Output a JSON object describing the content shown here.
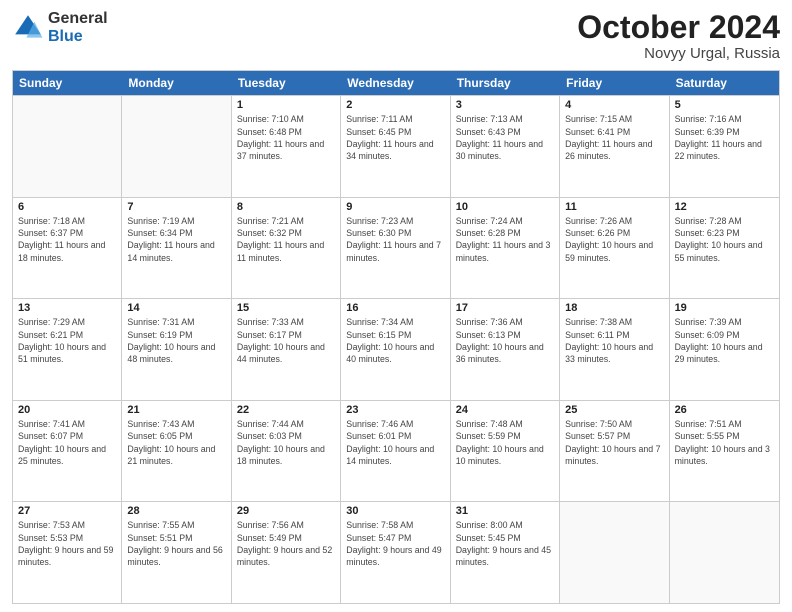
{
  "logo": {
    "general": "General",
    "blue": "Blue"
  },
  "title": "October 2024",
  "subtitle": "Novyy Urgal, Russia",
  "days": [
    "Sunday",
    "Monday",
    "Tuesday",
    "Wednesday",
    "Thursday",
    "Friday",
    "Saturday"
  ],
  "rows": [
    [
      {
        "day": "",
        "info": ""
      },
      {
        "day": "",
        "info": ""
      },
      {
        "day": "1",
        "info": "Sunrise: 7:10 AM\nSunset: 6:48 PM\nDaylight: 11 hours and 37 minutes."
      },
      {
        "day": "2",
        "info": "Sunrise: 7:11 AM\nSunset: 6:45 PM\nDaylight: 11 hours and 34 minutes."
      },
      {
        "day": "3",
        "info": "Sunrise: 7:13 AM\nSunset: 6:43 PM\nDaylight: 11 hours and 30 minutes."
      },
      {
        "day": "4",
        "info": "Sunrise: 7:15 AM\nSunset: 6:41 PM\nDaylight: 11 hours and 26 minutes."
      },
      {
        "day": "5",
        "info": "Sunrise: 7:16 AM\nSunset: 6:39 PM\nDaylight: 11 hours and 22 minutes."
      }
    ],
    [
      {
        "day": "6",
        "info": "Sunrise: 7:18 AM\nSunset: 6:37 PM\nDaylight: 11 hours and 18 minutes."
      },
      {
        "day": "7",
        "info": "Sunrise: 7:19 AM\nSunset: 6:34 PM\nDaylight: 11 hours and 14 minutes."
      },
      {
        "day": "8",
        "info": "Sunrise: 7:21 AM\nSunset: 6:32 PM\nDaylight: 11 hours and 11 minutes."
      },
      {
        "day": "9",
        "info": "Sunrise: 7:23 AM\nSunset: 6:30 PM\nDaylight: 11 hours and 7 minutes."
      },
      {
        "day": "10",
        "info": "Sunrise: 7:24 AM\nSunset: 6:28 PM\nDaylight: 11 hours and 3 minutes."
      },
      {
        "day": "11",
        "info": "Sunrise: 7:26 AM\nSunset: 6:26 PM\nDaylight: 10 hours and 59 minutes."
      },
      {
        "day": "12",
        "info": "Sunrise: 7:28 AM\nSunset: 6:23 PM\nDaylight: 10 hours and 55 minutes."
      }
    ],
    [
      {
        "day": "13",
        "info": "Sunrise: 7:29 AM\nSunset: 6:21 PM\nDaylight: 10 hours and 51 minutes."
      },
      {
        "day": "14",
        "info": "Sunrise: 7:31 AM\nSunset: 6:19 PM\nDaylight: 10 hours and 48 minutes."
      },
      {
        "day": "15",
        "info": "Sunrise: 7:33 AM\nSunset: 6:17 PM\nDaylight: 10 hours and 44 minutes."
      },
      {
        "day": "16",
        "info": "Sunrise: 7:34 AM\nSunset: 6:15 PM\nDaylight: 10 hours and 40 minutes."
      },
      {
        "day": "17",
        "info": "Sunrise: 7:36 AM\nSunset: 6:13 PM\nDaylight: 10 hours and 36 minutes."
      },
      {
        "day": "18",
        "info": "Sunrise: 7:38 AM\nSunset: 6:11 PM\nDaylight: 10 hours and 33 minutes."
      },
      {
        "day": "19",
        "info": "Sunrise: 7:39 AM\nSunset: 6:09 PM\nDaylight: 10 hours and 29 minutes."
      }
    ],
    [
      {
        "day": "20",
        "info": "Sunrise: 7:41 AM\nSunset: 6:07 PM\nDaylight: 10 hours and 25 minutes."
      },
      {
        "day": "21",
        "info": "Sunrise: 7:43 AM\nSunset: 6:05 PM\nDaylight: 10 hours and 21 minutes."
      },
      {
        "day": "22",
        "info": "Sunrise: 7:44 AM\nSunset: 6:03 PM\nDaylight: 10 hours and 18 minutes."
      },
      {
        "day": "23",
        "info": "Sunrise: 7:46 AM\nSunset: 6:01 PM\nDaylight: 10 hours and 14 minutes."
      },
      {
        "day": "24",
        "info": "Sunrise: 7:48 AM\nSunset: 5:59 PM\nDaylight: 10 hours and 10 minutes."
      },
      {
        "day": "25",
        "info": "Sunrise: 7:50 AM\nSunset: 5:57 PM\nDaylight: 10 hours and 7 minutes."
      },
      {
        "day": "26",
        "info": "Sunrise: 7:51 AM\nSunset: 5:55 PM\nDaylight: 10 hours and 3 minutes."
      }
    ],
    [
      {
        "day": "27",
        "info": "Sunrise: 7:53 AM\nSunset: 5:53 PM\nDaylight: 9 hours and 59 minutes."
      },
      {
        "day": "28",
        "info": "Sunrise: 7:55 AM\nSunset: 5:51 PM\nDaylight: 9 hours and 56 minutes."
      },
      {
        "day": "29",
        "info": "Sunrise: 7:56 AM\nSunset: 5:49 PM\nDaylight: 9 hours and 52 minutes."
      },
      {
        "day": "30",
        "info": "Sunrise: 7:58 AM\nSunset: 5:47 PM\nDaylight: 9 hours and 49 minutes."
      },
      {
        "day": "31",
        "info": "Sunrise: 8:00 AM\nSunset: 5:45 PM\nDaylight: 9 hours and 45 minutes."
      },
      {
        "day": "",
        "info": ""
      },
      {
        "day": "",
        "info": ""
      }
    ]
  ]
}
